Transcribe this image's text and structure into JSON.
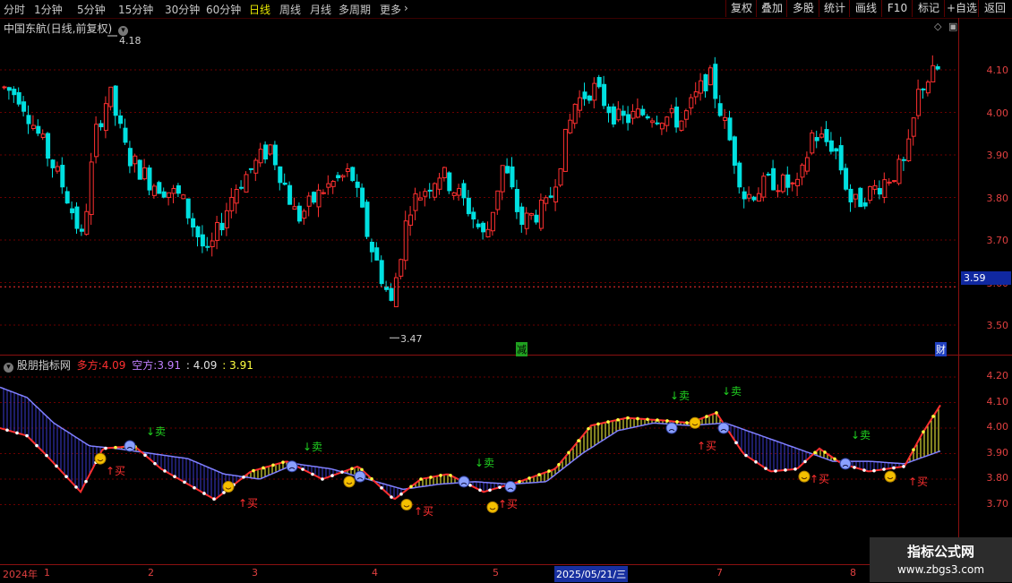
{
  "toolbar": {
    "periods": [
      "分时",
      "1分钟",
      "5分钟",
      "15分钟",
      "30分钟",
      "60分钟",
      "日线",
      "周线",
      "月线",
      "多周期",
      "更多"
    ],
    "active_period": "日线",
    "right_buttons": [
      "复权",
      "叠加",
      "多股",
      "统计",
      "画线",
      "F10",
      "标记",
      "+自选",
      "返回"
    ]
  },
  "price_panel": {
    "title": "中国东航(日线,前复权)",
    "y_ticks": [
      "4.10",
      "4.00",
      "3.90",
      "3.80",
      "3.70",
      "3.60",
      "3.50"
    ],
    "high_label": "4.18",
    "low_label": "3.47",
    "current_price": "3.59",
    "marker_jian": "减",
    "marker_cai": "财"
  },
  "indicator_panel": {
    "name": "股朋指标网",
    "duo_label": "多方:",
    "duo_value": "4.09",
    "kong_label": "空方:",
    "kong_value": "3.91",
    "extra_value1": ": 4.09",
    "extra_value2": ": 3.91",
    "y_ticks": [
      "4.20",
      "4.10",
      "4.00",
      "3.90",
      "3.80",
      "3.70"
    ],
    "buy_label": "↑买",
    "sell_label": "↓卖"
  },
  "date_axis": {
    "labels": [
      "2024年",
      "1",
      "2",
      "3",
      "4",
      "5",
      "2025/05/21/三",
      "7",
      "8"
    ]
  },
  "watermark": {
    "line1": "指标公式网",
    "line2": "www.zbgs3.com"
  },
  "colors": {
    "up": "#ff3030",
    "down": "#00e0e0",
    "duo_line": "#ffff40",
    "kong_line": "#8080ff",
    "grid": "#6a0000",
    "text_red": "#e04040"
  }
}
